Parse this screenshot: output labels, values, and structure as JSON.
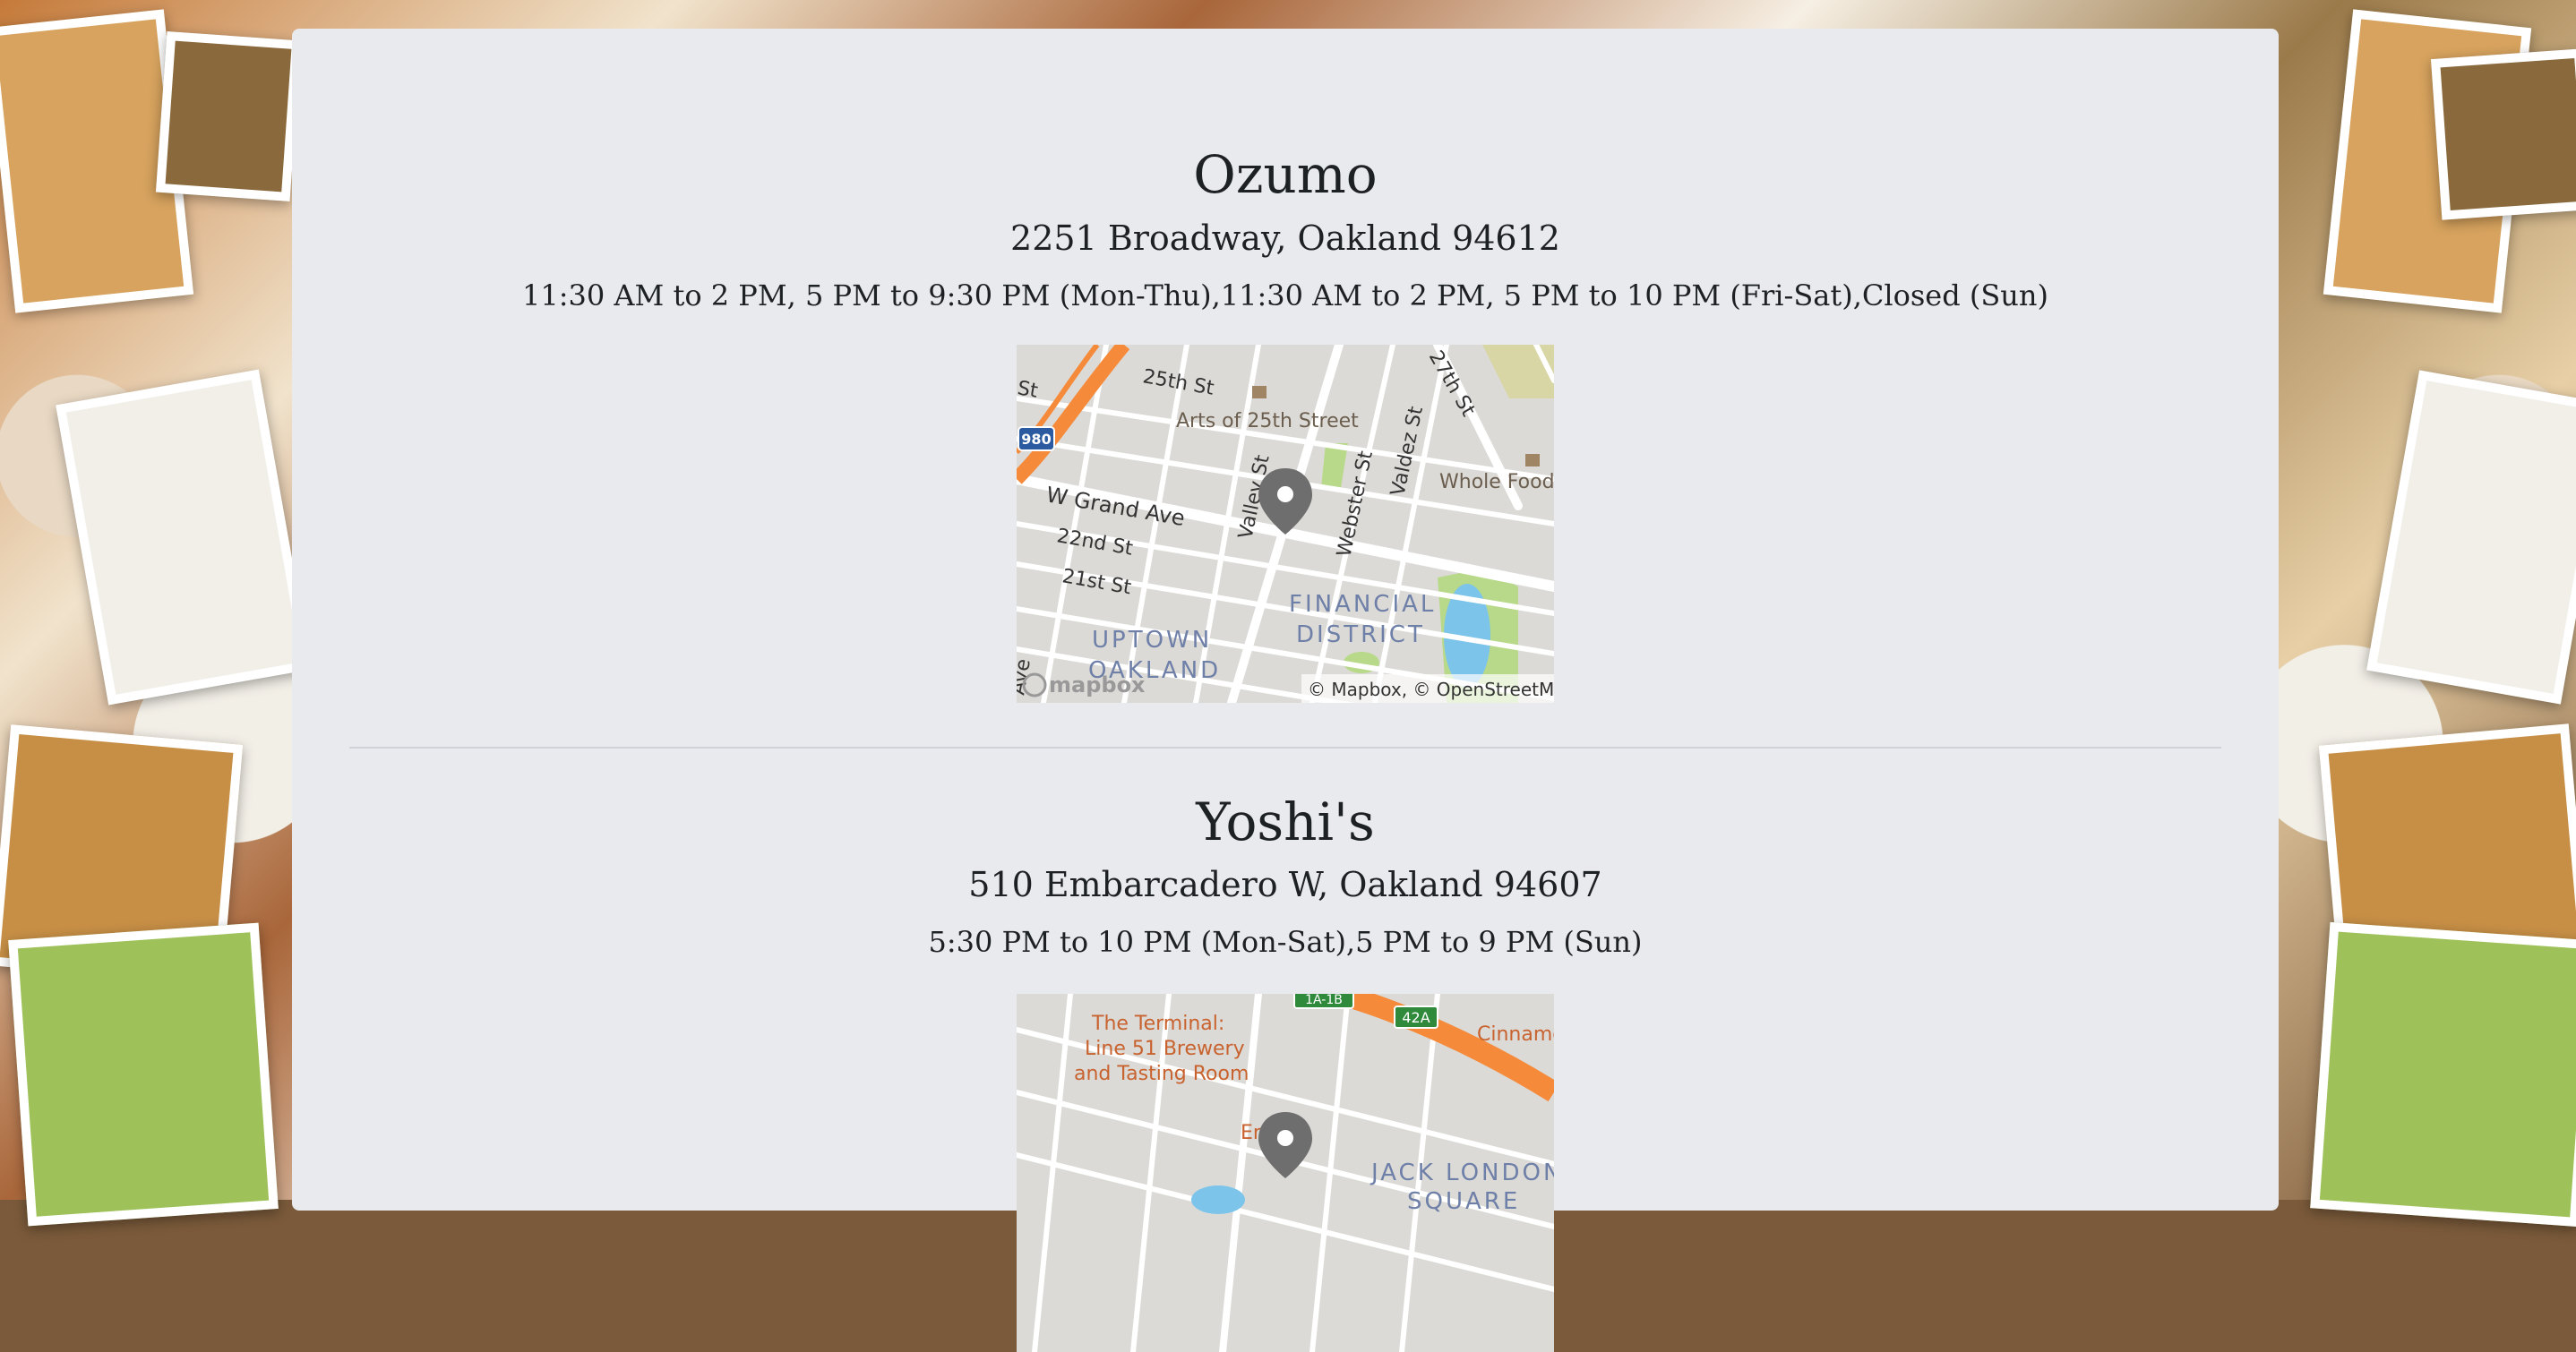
{
  "restaurants": [
    {
      "name": "Ozumo",
      "address": "2251 Broadway, Oakland 94612",
      "hours": "11:30 AM to 2 PM, 5 PM to 9:30 PM (Mon-Thu),11:30 AM to 2 PM, 5 PM to 10 PM (Fri-Sat),Closed (Sun)",
      "map": {
        "labels": {
          "st25": "25th St",
          "st27": "27th St",
          "arts": "Arts of 25th Street",
          "valley": "Valley St",
          "webster": "Webster St",
          "valdez": "Valdez St",
          "whole_foods": "Whole Foods",
          "grand": "W Grand Ave",
          "st22": "22nd St",
          "st21": "21st St",
          "uptown1": "UPTOWN",
          "uptown2": "OAKLAND",
          "fin1": "FINANCIAL",
          "fin2": "DISTRICT",
          "shield": "980",
          "st_left": "St",
          "ave_left": "Ave"
        },
        "logo": "mapbox",
        "attribution": "© Mapbox, © OpenStreetMap"
      }
    },
    {
      "name": "Yoshi's",
      "address": "510 Embarcadero W, Oakland 94607",
      "hours": "5:30 PM to 10 PM (Mon-Sat),5 PM to 9 PM (Sun)",
      "map": {
        "labels": {
          "terminal1": "The Terminal:",
          "terminal2": "Line 51 Brewery",
          "terminal3": "and Tasting Room",
          "shield1": "1A-1B",
          "shield2": "42A",
          "cinnamon": "Cinnamo",
          "eng": "En   tro",
          "jack1": "JACK LONDON",
          "jack2": "SQUARE"
        }
      }
    }
  ]
}
